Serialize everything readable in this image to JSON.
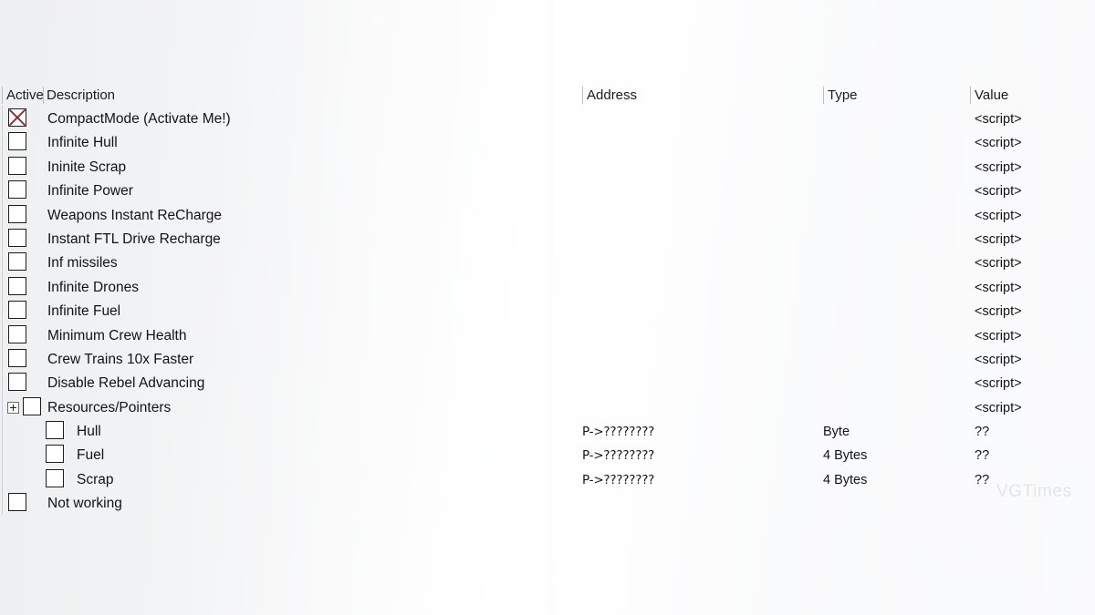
{
  "table": {
    "headers": {
      "active": "Active",
      "description": "Description",
      "address": "Address",
      "type": "Type",
      "value": "Value"
    },
    "rows": [
      {
        "description": "CompactMode (Activate  Me!)",
        "address": "",
        "type": "",
        "value": "<script>",
        "checked": true,
        "level": 0,
        "expander": false
      },
      {
        "description": "Infinite Hull",
        "address": "",
        "type": "",
        "value": "<script>",
        "checked": false,
        "level": 0,
        "expander": false
      },
      {
        "description": "Ininite Scrap",
        "address": "",
        "type": "",
        "value": "<script>",
        "checked": false,
        "level": 0,
        "expander": false
      },
      {
        "description": "Infinite Power",
        "address": "",
        "type": "",
        "value": "<script>",
        "checked": false,
        "level": 0,
        "expander": false
      },
      {
        "description": "Weapons Instant ReCharge",
        "address": "",
        "type": "",
        "value": "<script>",
        "checked": false,
        "level": 0,
        "expander": false
      },
      {
        "description": "Instant FTL Drive Recharge",
        "address": "",
        "type": "",
        "value": "<script>",
        "checked": false,
        "level": 0,
        "expander": false
      },
      {
        "description": "Inf missiles",
        "address": "",
        "type": "",
        "value": "<script>",
        "checked": false,
        "level": 0,
        "expander": false
      },
      {
        "description": "Infinite Drones",
        "address": "",
        "type": "",
        "value": "<script>",
        "checked": false,
        "level": 0,
        "expander": false
      },
      {
        "description": "Infinite Fuel",
        "address": "",
        "type": "",
        "value": "<script>",
        "checked": false,
        "level": 0,
        "expander": false
      },
      {
        "description": "Minimum Crew Health",
        "address": "",
        "type": "",
        "value": "<script>",
        "checked": false,
        "level": 0,
        "expander": false
      },
      {
        "description": "Crew Trains 10x Faster",
        "address": "",
        "type": "",
        "value": "<script>",
        "checked": false,
        "level": 0,
        "expander": false
      },
      {
        "description": "Disable Rebel Advancing",
        "address": "",
        "type": "",
        "value": "<script>",
        "checked": false,
        "level": 0,
        "expander": false
      },
      {
        "description": "Resources/Pointers",
        "address": "",
        "type": "",
        "value": "<script>",
        "checked": false,
        "level": 0,
        "expander": true
      },
      {
        "description": "Hull",
        "address": "P->????????",
        "type": "Byte",
        "value": "??",
        "checked": false,
        "level": 1,
        "expander": false
      },
      {
        "description": "Fuel",
        "address": "P->????????",
        "type": "4 Bytes",
        "value": "??",
        "checked": false,
        "level": 1,
        "expander": false
      },
      {
        "description": "Scrap",
        "address": "P->????????",
        "type": "4 Bytes",
        "value": "??",
        "checked": false,
        "level": 1,
        "expander": false
      },
      {
        "description": "Not working",
        "address": "",
        "type": "",
        "value": "",
        "checked": false,
        "level": 0,
        "expander": false
      }
    ]
  },
  "watermark": {
    "text": "VGTimes"
  },
  "colors": {
    "checkbox_border": "#1d1d1d",
    "check_x": "#8c2323",
    "text": "#131313",
    "header_separator": "#b9bcc0",
    "watermark": "#e2e4e6",
    "background": "#ffffff"
  },
  "icons": {
    "checked": "x-mark-icon",
    "expander": "plus-square-icon"
  }
}
